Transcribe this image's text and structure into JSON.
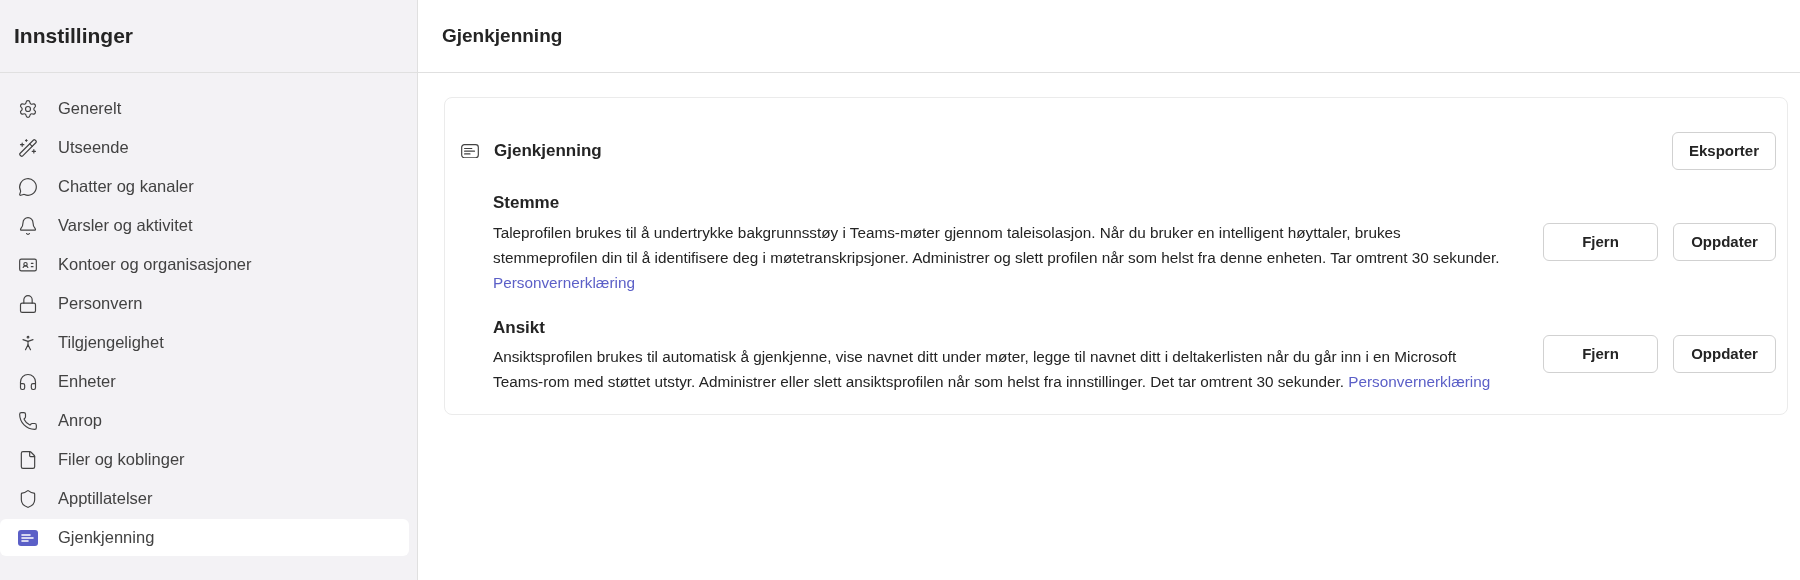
{
  "sidebar": {
    "title": "Innstillinger",
    "items": [
      {
        "label": "Generelt",
        "selected": false
      },
      {
        "label": "Utseende",
        "selected": false
      },
      {
        "label": "Chatter og kanaler",
        "selected": false
      },
      {
        "label": "Varsler og aktivitet",
        "selected": false
      },
      {
        "label": "Kontoer og organisasjoner",
        "selected": false
      },
      {
        "label": "Personvern",
        "selected": false
      },
      {
        "label": "Tilgjengelighet",
        "selected": false
      },
      {
        "label": "Enheter",
        "selected": false
      },
      {
        "label": "Anrop",
        "selected": false
      },
      {
        "label": "Filer og koblinger",
        "selected": false
      },
      {
        "label": "Apptillatelser",
        "selected": false
      },
      {
        "label": "Gjenkjenning",
        "selected": true
      }
    ]
  },
  "main": {
    "title": "Gjenkjenning",
    "card": {
      "title": "Gjenkjenning",
      "export_button": "Eksporter",
      "sections": [
        {
          "heading": "Stemme",
          "text": "Taleprofilen brukes til å undertrykke bakgrunnsstøy i Teams-møter gjennom taleisolasjon. Når du bruker en intelligent høyttaler, brukes stemmeprofilen din til å identifisere deg i møtetranskripsjoner. Administrer og slett profilen når som helst fra denne enheten. Tar omtrent 30 sekunder.",
          "link": "Personvernerklæring",
          "buttons": [
            "Fjern",
            "Oppdater"
          ]
        },
        {
          "heading": "Ansikt",
          "text": "Ansiktsprofilen brukes til automatisk å gjenkjenne, vise navnet ditt under møter, legge til navnet ditt i deltakerlisten når du går inn i en Microsoft Teams-rom med støttet utstyr. Administrer eller slett ansiktsprofilen når som helst fra innstillinger. Det tar omtrent 30 sekunder.",
          "link": "Personvernerklæring",
          "buttons": [
            "Fjern",
            "Oppdater"
          ]
        }
      ]
    }
  }
}
